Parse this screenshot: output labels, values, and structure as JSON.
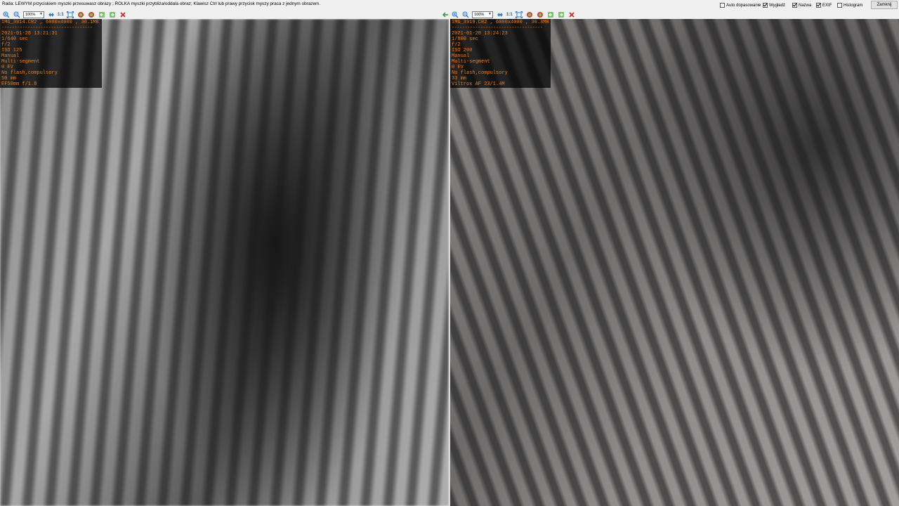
{
  "hint": "Rada: LEWYM przyciskiem myszki przesuwasz obrazy ; ROLKA myszki przybliża/oddala obraz; Klawisz Ctrl lub prawy przycisk myszy praca z jednym obrazem.",
  "options": {
    "auto_fit": {
      "label": "Auto dopasowanie",
      "checked": false
    },
    "smooth": {
      "label": "Wygładź",
      "checked": true
    },
    "name": {
      "label": "Nazwa",
      "checked": true
    },
    "exif": {
      "label": "EXIF",
      "checked": true
    },
    "histogram": {
      "label": "Histogram",
      "checked": false
    }
  },
  "close_label": "Zamknij",
  "left": {
    "zoom": "100%",
    "ratio": "1:1",
    "exif": {
      "header": "IMG_3914.CR2 , 6000x4000 , 30.1MB",
      "separator": "-----------------------------------",
      "lines": [
        "2021-01-28 13:21:31",
        "1/640 sec",
        "f/2",
        "ISO 125",
        "Manual",
        "Multi-segment",
        "0 EV",
        "No flash,compulsory",
        "50 mm",
        "EF50mm f/1.8"
      ]
    }
  },
  "right": {
    "zoom": "100%",
    "ratio": "1:1",
    "exif": {
      "header": "IMG_3919.CR2 , 6000x4000 , 30.3MB",
      "separator": "-----------------------------------",
      "lines": [
        "2021-01-28 13:24:23",
        "1/800 sec",
        "f/2",
        "ISO 200",
        "Manual",
        "Multi-segment",
        "0 EV",
        "No flash,compulsory",
        "33 mm",
        "Viltrox AF 23/1.4M"
      ]
    }
  },
  "colors": {
    "exif_text": "#e87c1e",
    "accent_blue": "#2e7bcf",
    "accent_green": "#2f9a3a",
    "accent_red": "#d02020"
  }
}
